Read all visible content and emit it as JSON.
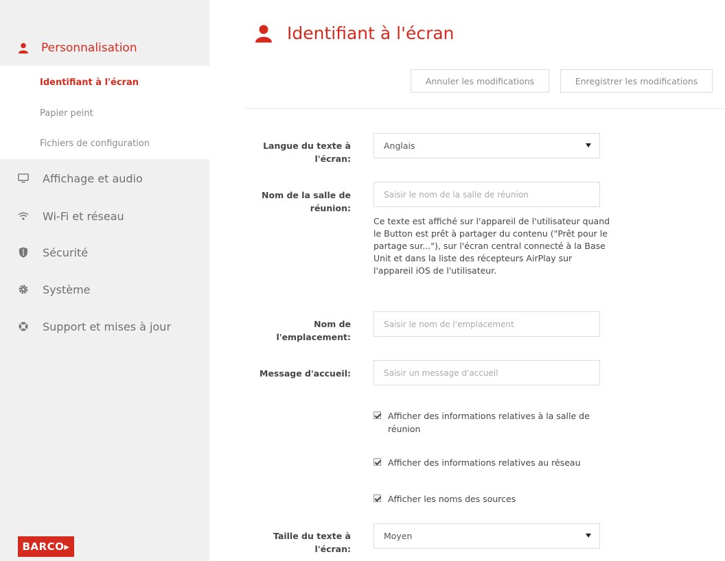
{
  "sidebar": {
    "group": {
      "label": "Personnalisation",
      "icon": "user-icon"
    },
    "subitems": [
      {
        "label": "Identifiant à l'écran",
        "active": true
      },
      {
        "label": "Papier peint",
        "active": false
      },
      {
        "label": "Fichiers de configuration",
        "active": false
      }
    ],
    "items": [
      {
        "label": "Affichage et audio",
        "icon": "monitor-icon"
      },
      {
        "label": "Wi-Fi et réseau",
        "icon": "wifi-icon"
      },
      {
        "label": "Sécurité",
        "icon": "shield-icon"
      },
      {
        "label": "Système",
        "icon": "gear-icon"
      },
      {
        "label": "Support et mises à jour",
        "icon": "lifebuoy-icon"
      }
    ],
    "logo": "BARCO"
  },
  "page": {
    "title": "Identifiant à l'écran",
    "cancel_label": "Annuler les modifications",
    "save_label": "Enregistrer les modifications"
  },
  "form": {
    "language": {
      "label": "Langue du texte à l'écran:",
      "value": "Anglais"
    },
    "room_name": {
      "label": "Nom de la salle de réunion:",
      "placeholder": "Saisir le nom de la salle de réunion",
      "help": "Ce texte est affiché sur l'appareil de l'utilisateur quand le Button est prêt à partager du contenu (\"Prêt pour le partage sur...\"), sur l'écran central connecté à la Base Unit et dans la liste des récepteurs AirPlay sur l'appareil iOS de l'utilisateur."
    },
    "location": {
      "label": "Nom de l'emplacement:",
      "placeholder": "Saisir le nom de l'emplacement"
    },
    "welcome": {
      "label": "Message d'accueil:",
      "placeholder": "Saisir un message d'accueil"
    },
    "checkboxes": [
      {
        "label": "Afficher des informations relatives à la salle de réunion",
        "checked": true
      },
      {
        "label": "Afficher des informations relatives au réseau",
        "checked": true
      },
      {
        "label": "Afficher les noms des sources",
        "checked": true
      }
    ],
    "text_size": {
      "label": "Taille du texte à l'écran:",
      "value": "Moyen"
    }
  },
  "colors": {
    "accent": "#d52b1e",
    "sidebar_bg": "#f0f0f0"
  }
}
